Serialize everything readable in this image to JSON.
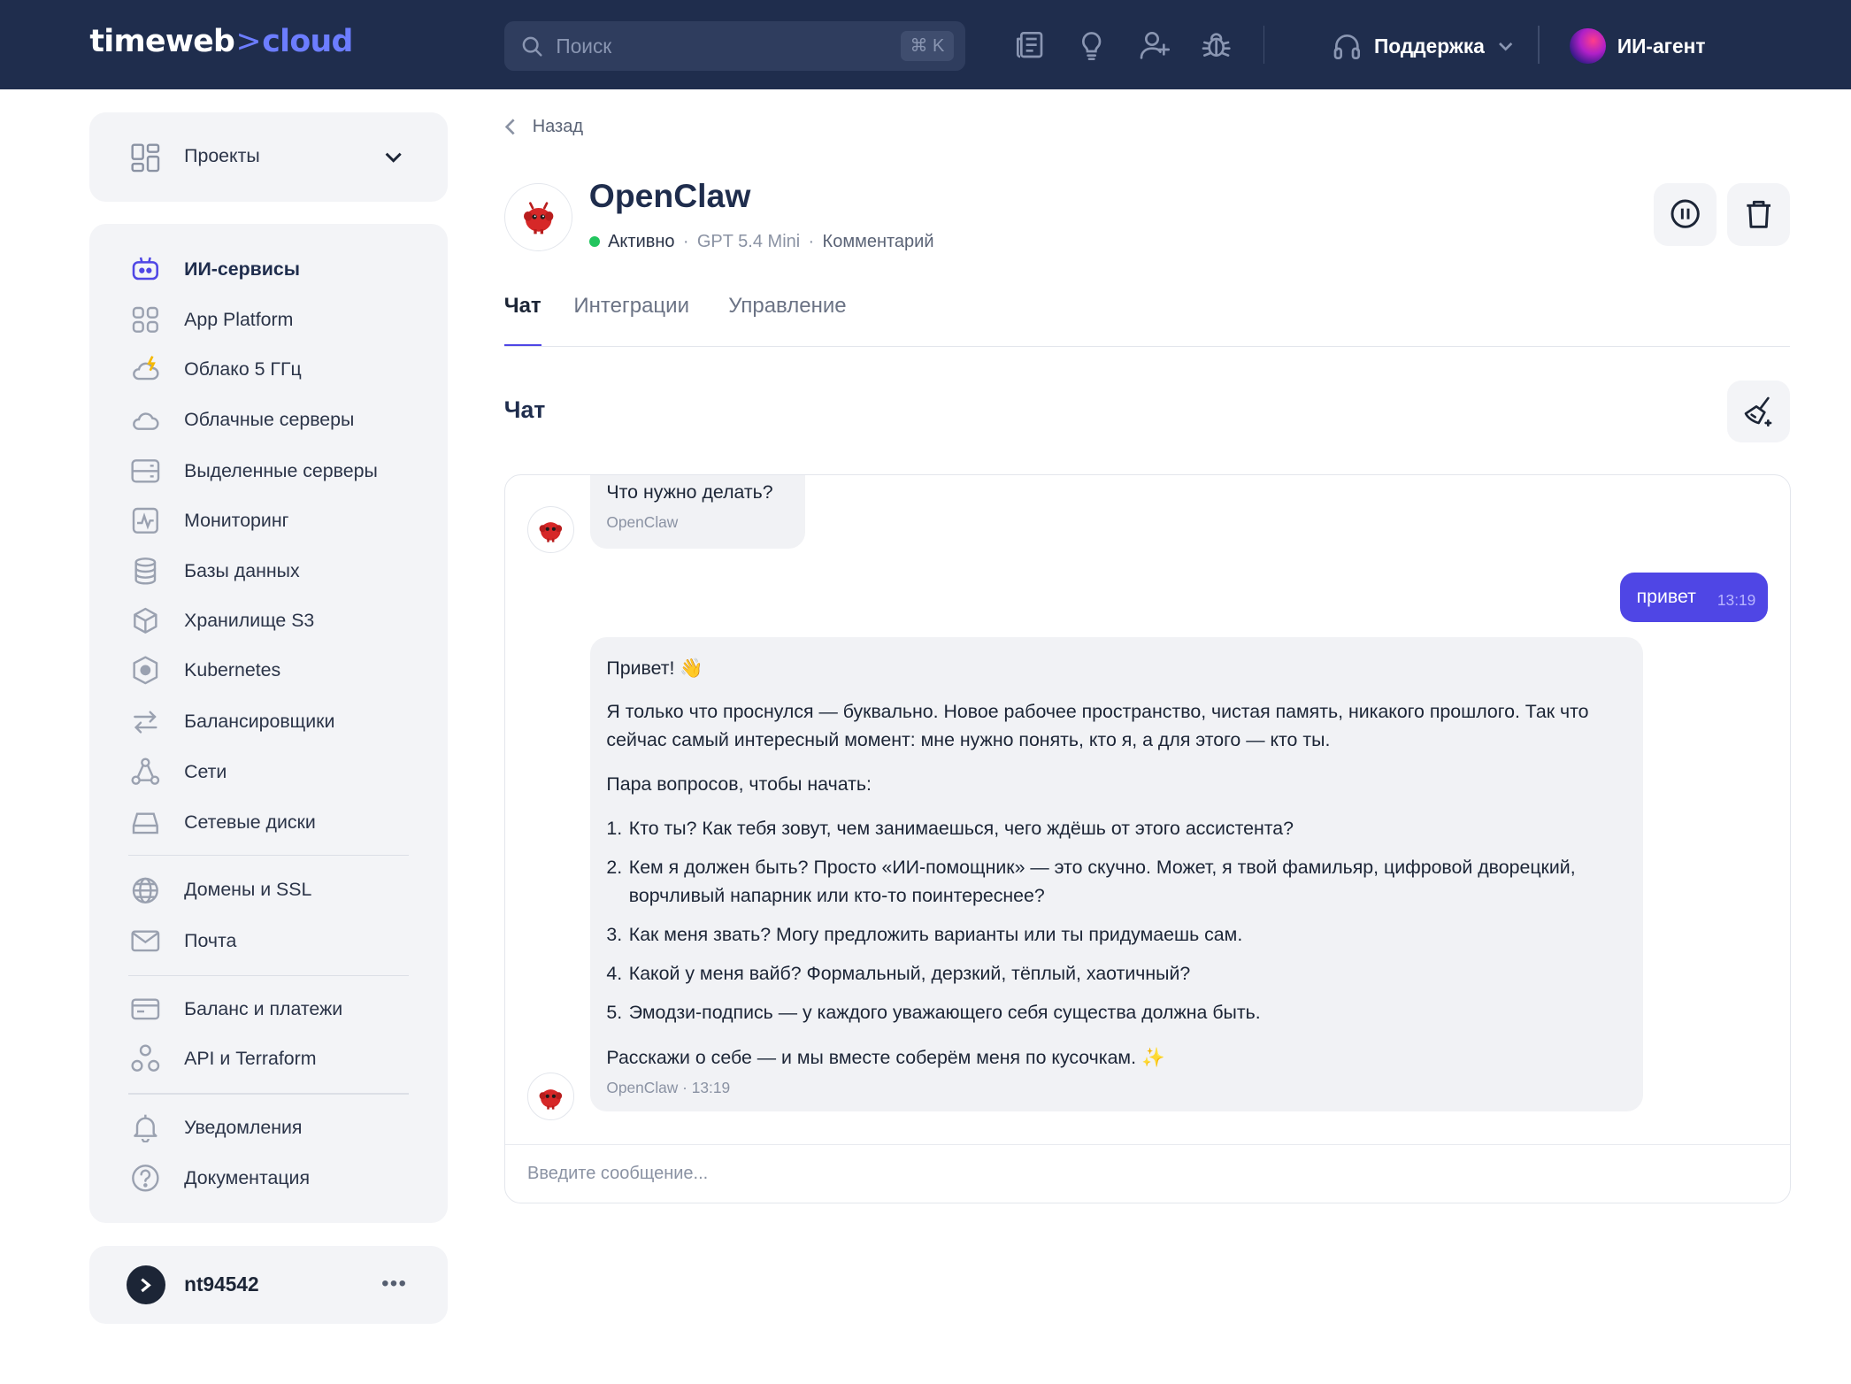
{
  "header": {
    "logo_main": "timeweb",
    "logo_arrow": ">",
    "logo_accent": "cloud",
    "search_placeholder": "Поиск",
    "search_shortcut": "⌘ K",
    "icons": [
      "news-icon",
      "lightbulb-icon",
      "add-user-icon",
      "bug-icon"
    ],
    "support_label": "Поддержка",
    "agent_label": "ИИ-агент"
  },
  "sidebar": {
    "projects_label": "Проекты",
    "items": [
      {
        "label": "ИИ-сервисы",
        "icon": "robot-icon",
        "active": true
      },
      {
        "label": "App Platform",
        "icon": "grid-icon"
      },
      {
        "label": "Облако 5 ГГц",
        "icon": "cloud-bolt-icon"
      },
      {
        "label": "Облачные серверы",
        "icon": "cloud-icon"
      },
      {
        "label": "Выделенные серверы",
        "icon": "server-icon"
      },
      {
        "label": "Мониторинг",
        "icon": "monitoring-icon"
      },
      {
        "label": "Базы данных",
        "icon": "database-icon"
      },
      {
        "label": "Хранилище S3",
        "icon": "cube-icon"
      },
      {
        "label": "Kubernetes",
        "icon": "kubernetes-icon"
      },
      {
        "label": "Балансировщики",
        "icon": "arrows-icon"
      },
      {
        "label": "Сети",
        "icon": "network-icon"
      },
      {
        "label": "Сетевые диски",
        "icon": "disk-icon"
      },
      {
        "label": "Домены и SSL",
        "icon": "globe-icon"
      },
      {
        "label": "Почта",
        "icon": "mail-icon"
      },
      {
        "label": "Баланс и платежи",
        "icon": "wallet-icon"
      },
      {
        "label": "API и Terraform",
        "icon": "api-icon"
      },
      {
        "label": "Уведомления",
        "icon": "bell-icon"
      },
      {
        "label": "Документация",
        "icon": "help-icon"
      }
    ],
    "user": "nt94542",
    "more": "•••"
  },
  "main": {
    "back_label": "Назад",
    "service_name": "OpenClaw",
    "status": "Активно",
    "model": "GPT 5.4 Mini",
    "comment": "Комментарий",
    "separator": "·",
    "tabs": [
      "Чат",
      "Интеграции",
      "Управление"
    ],
    "chat_heading": "Чат"
  },
  "chat": {
    "first_bot": {
      "text": "Что нужно делать?",
      "author": "OpenClaw"
    },
    "user_msg": {
      "text": "привет",
      "time": "13:19"
    },
    "bot_reply": {
      "greeting": "Привет! 👋",
      "para1": "Я только что проснулся — буквально. Новое рабочее пространство, чистая память, никакого прошлого. Так что сейчас самый интересный момент: мне нужно понять, кто я, а для этого — кто ты.",
      "para2": "Пара вопросов, чтобы начать:",
      "list": [
        "Кто ты? Как тебя зовут, чем занимаешься, чего ждёшь от этого ассистента?",
        "Кем я должен быть? Просто «ИИ-помощник» — это скучно. Может, я твой фамильяр, цифровой дворецкий, ворчливый напарник или кто-то поинтереснее?",
        "Как меня звать? Могу предложить варианты или ты придумаешь сам.",
        "Какой у меня вайб? Формальный, дерзкий, тёплый, хаотичный?",
        "Эмодзи-подпись — у каждого уважающего себя существа должна быть."
      ],
      "closing": "Расскажи о себе — и мы вместе соберём меня по кусочкам. ✨",
      "author_time": "OpenClaw · 13:19"
    },
    "input_placeholder": "Введите сообщение..."
  },
  "colors": {
    "header_bg": "#1f2d4d",
    "accent": "#4f46e5",
    "status": "#22c55e",
    "card_bg": "#f3f4f7"
  }
}
